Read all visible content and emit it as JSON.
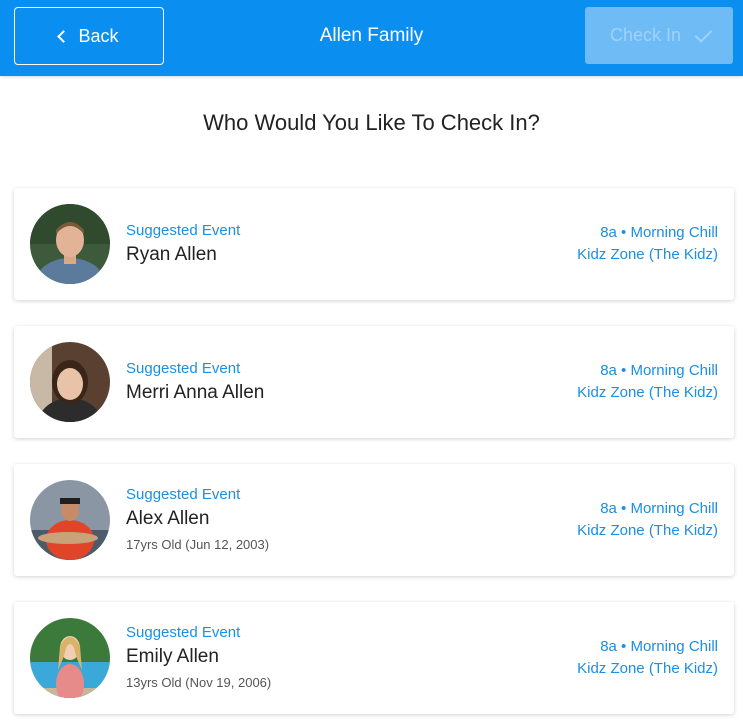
{
  "header": {
    "back_label": "Back",
    "title": "Allen Family",
    "checkin_label": "Check In",
    "colors": {
      "background": "#0a8ff0",
      "checkin_disabled": "#6fbbf6"
    }
  },
  "prompt": "Who Would You Like To Check In?",
  "people": [
    {
      "suggested_label": "Suggested Event",
      "name": "Ryan Allen",
      "age": "",
      "event_time": "8a • Morning Chill",
      "event_room": "Kidz Zone (The Kidz)"
    },
    {
      "suggested_label": "Suggested Event",
      "name": "Merri Anna Allen",
      "age": "",
      "event_time": "8a • Morning Chill",
      "event_room": "Kidz Zone (The Kidz)"
    },
    {
      "suggested_label": "Suggested Event",
      "name": "Alex Allen",
      "age": "17yrs Old (Jun 12, 2003)",
      "event_time": "8a • Morning Chill",
      "event_room": "Kidz Zone (The Kidz)"
    },
    {
      "suggested_label": "Suggested Event",
      "name": "Emily Allen",
      "age": "13yrs Old (Nov 19, 2006)",
      "event_time": "8a • Morning Chill",
      "event_room": "Kidz Zone (The Kidz)"
    }
  ],
  "accent_color": "#1a8fe3"
}
